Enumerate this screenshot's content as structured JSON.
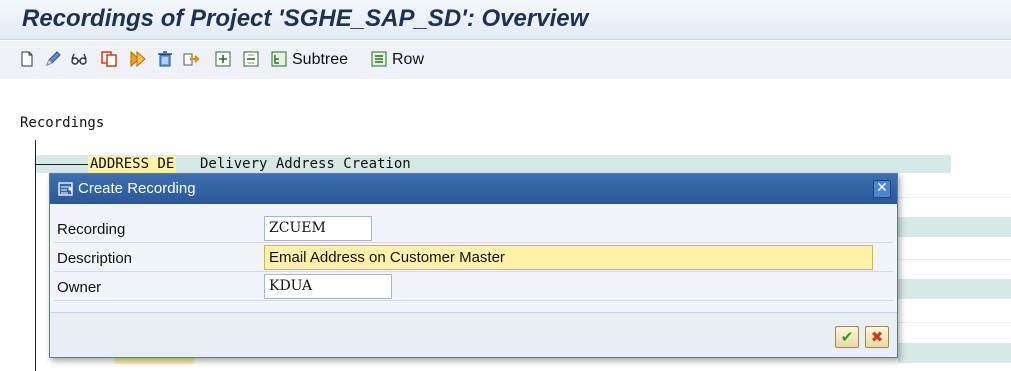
{
  "window": {
    "title": "Recordings of Project 'SGHE_SAP_SD': Overview"
  },
  "toolbar": {
    "icons": [
      "new-document-icon",
      "edit-pencil-icon",
      "glasses-display-icon",
      "copy-icon",
      "execute-icon",
      "delete-trash-icon",
      "import-icon",
      "expand-icon",
      "collapse-icon"
    ],
    "subtree_label": "Subtree",
    "row_label": "Row"
  },
  "tree": {
    "root_label": "Recordings",
    "rows": [
      {
        "id": "ADDRESS DE",
        "description": "Delivery Address Creation"
      }
    ]
  },
  "dialog": {
    "title": "Create Recording",
    "fields": [
      {
        "label": "Recording",
        "value": "ZCUEM"
      },
      {
        "label": "Description",
        "value": "Email Address on Customer Master"
      },
      {
        "label": "Owner",
        "value": "KDUA"
      }
    ],
    "ok_icon": "checkmark-icon",
    "cancel_icon": "cancel-x-icon",
    "colors": {
      "header": "#2f5e9f",
      "highlight": "#fff2a8",
      "ok": "#2f9a24",
      "cancel": "#d23b16"
    }
  }
}
